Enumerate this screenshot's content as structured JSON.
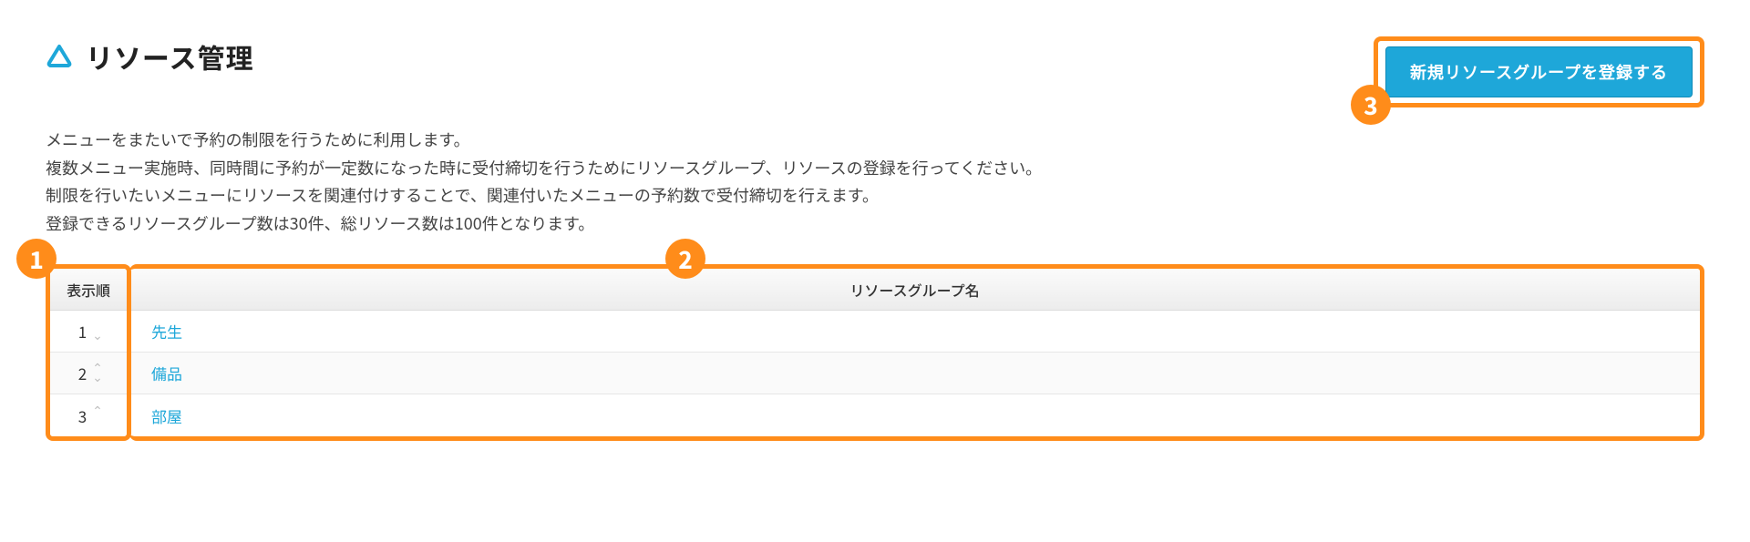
{
  "header": {
    "title": "リソース管理",
    "button_label": "新規リソースグループを登録する"
  },
  "description": {
    "line1": "メニューをまたいで予約の制限を行うために利用します。",
    "line2": "複数メニュー実施時、同時間に予約が一定数になった時に受付締切を行うためにリソースグループ、リソースの登録を行ってください。",
    "line3": "制限を行いたいメニューにリソースを関連付けすることで、関連付いたメニューの予約数で受付締切を行えます。",
    "line4": "登録できるリソースグループ数は30件、総リソース数は100件となります。"
  },
  "table": {
    "header_order": "表示順",
    "header_group": "リソースグループ名",
    "rows": [
      {
        "order": "1",
        "name": "先生"
      },
      {
        "order": "2",
        "name": "備品"
      },
      {
        "order": "3",
        "name": "部屋"
      }
    ]
  },
  "annotations": {
    "b1": "1",
    "b2": "2",
    "b3": "3"
  }
}
